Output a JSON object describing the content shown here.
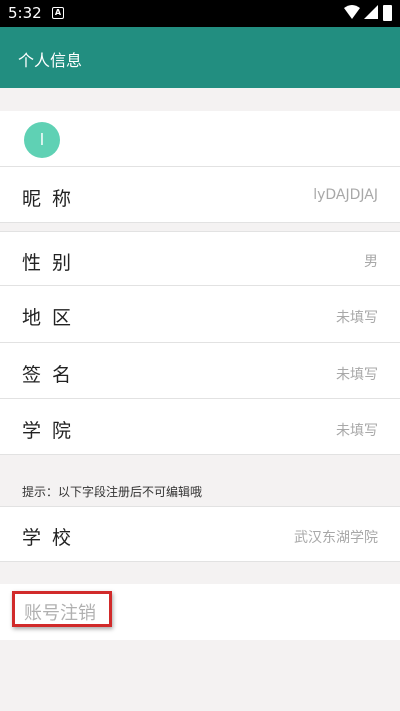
{
  "status_bar": {
    "time": "5:32",
    "notification_icon": "A",
    "icons": [
      "wifi-icon",
      "signal-icon",
      "battery-icon"
    ]
  },
  "toolbar": {
    "title": "个人信息"
  },
  "avatar": {
    "letter": "l",
    "color": "#5fd1b4"
  },
  "profile": {
    "nickname": {
      "label": "昵称",
      "value": "lyDAJDJAJ"
    },
    "gender": {
      "label": "性别",
      "value": "男"
    },
    "region": {
      "label": "地区",
      "value": "未填写"
    },
    "signature": {
      "label": "签名",
      "value": "未填写"
    },
    "college": {
      "label": "学院",
      "value": "未填写"
    }
  },
  "hint": "提示：以下字段注册后不可编辑哦",
  "school": {
    "label": "学校",
    "value": "武汉东湖学院"
  },
  "account_cancel": {
    "label": "账号注销"
  },
  "colors": {
    "accent": "#228e80",
    "highlight_border": "#d12a2a"
  }
}
